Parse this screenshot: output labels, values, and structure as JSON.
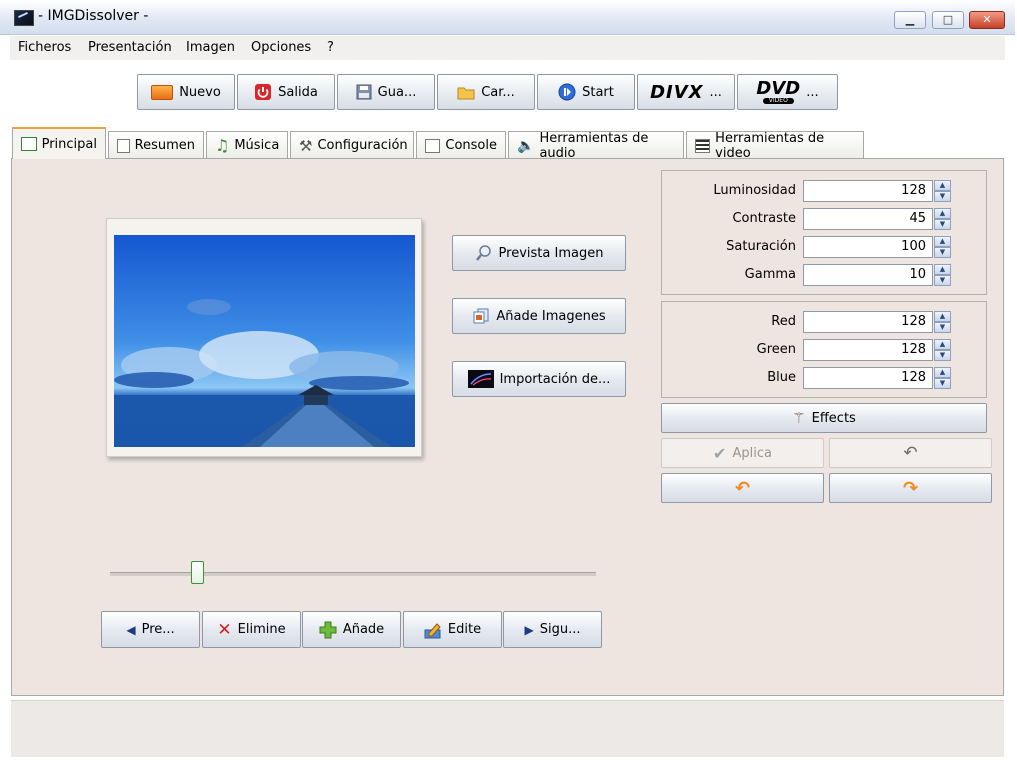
{
  "window": {
    "title": "- IMGDissolver -"
  },
  "menu": [
    "Ficheros",
    "Presentación",
    "Imagen",
    "Opciones",
    "?"
  ],
  "toolbar": {
    "nuevo": "Nuevo",
    "salida": "Salida",
    "guardar": "Gua...",
    "cargar": "Car...",
    "start": "Start",
    "divx_logo": "DIVX",
    "divx_suffix": "...",
    "dvd_logo": "DVD",
    "dvd_logo_sub": "VIDEO",
    "dvd_suffix": "..."
  },
  "tabs": [
    "Principal",
    "Resumen",
    "Música",
    "Configuración",
    "Console",
    "Herramientas de audio",
    "Herramientas de video"
  ],
  "actions": {
    "prevista": "Prevista Imagen",
    "anade_imagenes": "Añade Imagenes",
    "importacion": "Importación de..."
  },
  "navigation": {
    "previous": "Pre...",
    "delete": "Elimine",
    "add": "Añade",
    "edit": "Edite",
    "next": "Sigu..."
  },
  "slider": {
    "value_fraction": 0.18
  },
  "image_settings": [
    {
      "label": "Luminosidad",
      "value": "128"
    },
    {
      "label": "Contraste",
      "value": "45"
    },
    {
      "label": "Saturación",
      "value": "100"
    },
    {
      "label": "Gamma",
      "value": "10"
    }
  ],
  "color_settings": [
    {
      "label": "Red",
      "value": "128"
    },
    {
      "label": "Green",
      "value": "128"
    },
    {
      "label": "Blue",
      "value": "128"
    }
  ],
  "buttons": {
    "effects": "Effects",
    "apply": "Aplica"
  }
}
